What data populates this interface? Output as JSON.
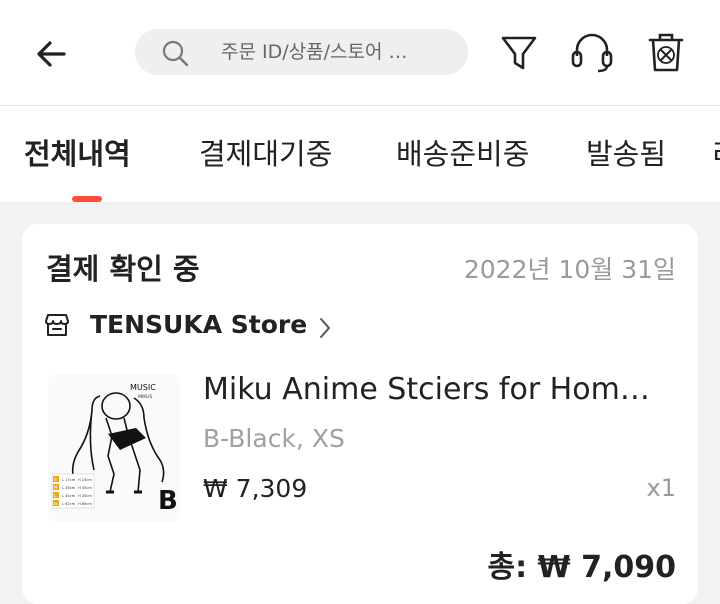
{
  "header": {
    "search_placeholder": "주문 ID/상품/스토어 …",
    "icons": {
      "back": "back-arrow-icon",
      "search": "search-icon",
      "filter": "filter-icon",
      "support": "headset-icon",
      "trash": "trash-icon"
    }
  },
  "tabs": [
    {
      "label": "전체내역",
      "active": true
    },
    {
      "label": "결제대기중",
      "active": false
    },
    {
      "label": "배송준비중",
      "active": false
    },
    {
      "label": "발송됨",
      "active": false
    },
    {
      "label": "리",
      "active": false
    }
  ],
  "order": {
    "status": "결제 확인 중",
    "date": "2022년 10월 31일",
    "store_name": "TENSUKA Store",
    "product": {
      "title": "Miku Anime Stciers for Hom…",
      "variant": "B-Black, XS",
      "price": "₩ 7,309",
      "quantity": "x1",
      "thumbnail": {
        "heading": "MUSIC",
        "subheading": "MIKUS",
        "letter": "B",
        "size_rows": [
          {
            "key": "S",
            "l": "L 17cm",
            "h": "H 23cm"
          },
          {
            "key": "M",
            "l": "L 26cm",
            "h": "H 35cm"
          },
          {
            "key": "L",
            "l": "L 45cm",
            "h": "H 35cm"
          },
          {
            "key": "XL",
            "l": "L 62cm",
            "h": "H 89cm"
          }
        ]
      }
    },
    "total": "총: ₩ 7,090"
  },
  "colors": {
    "accent": "#ff4d3a",
    "muted_text": "#9a9a9a",
    "background": "#f2f2f2",
    "card": "#ffffff"
  }
}
